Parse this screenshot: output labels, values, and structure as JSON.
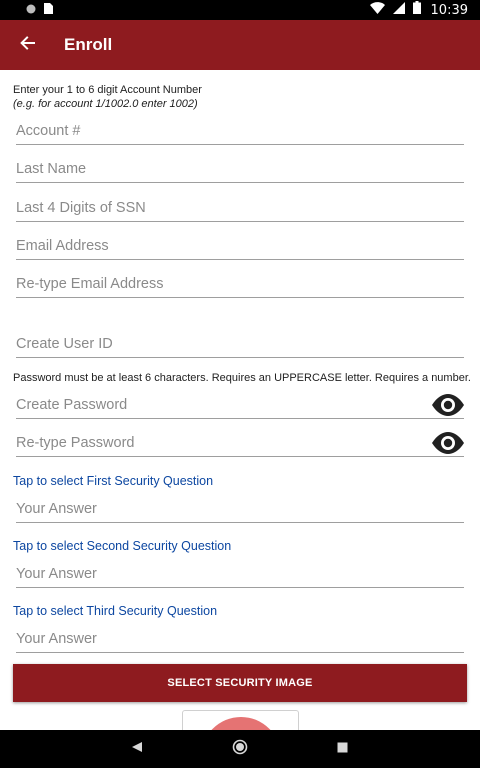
{
  "status_bar": {
    "time": "10:39"
  },
  "app_bar": {
    "title": "Enroll"
  },
  "form": {
    "instruction_account": "Enter your 1 to 6 digit Account Number",
    "instruction_example": "(e.g. for account 1/1002.0 enter 1002)",
    "account_placeholder": "Account #",
    "last_name_placeholder": "Last Name",
    "ssn_placeholder": "Last 4 Digits of SSN",
    "email_placeholder": "Email Address",
    "email_retype_placeholder": "Re-type Email Address",
    "user_id_placeholder": "Create User ID",
    "password_rules": "Password must be at least 6 characters. Requires an UPPERCASE letter. Requires a number.",
    "password_placeholder": "Create Password",
    "password_retype_placeholder": "Re-type Password",
    "security_questions": [
      {
        "link": "Tap to select First Security Question",
        "answer_placeholder": "Your Answer"
      },
      {
        "link": "Tap to select Second Security Question",
        "answer_placeholder": "Your Answer"
      },
      {
        "link": "Tap to select Third Security Question",
        "answer_placeholder": "Your Answer"
      }
    ],
    "select_image_button": "SELECT SECURITY IMAGE"
  },
  "icons": {
    "back": "arrow-left-icon",
    "password_visibility": "eye-icon",
    "nav_back": "triangle-back-icon",
    "nav_home": "circle-home-icon",
    "nav_recents": "square-recents-icon"
  },
  "colors": {
    "primary": "#8e1b1f",
    "link": "#0d47a1",
    "security_image": "#e57373"
  }
}
